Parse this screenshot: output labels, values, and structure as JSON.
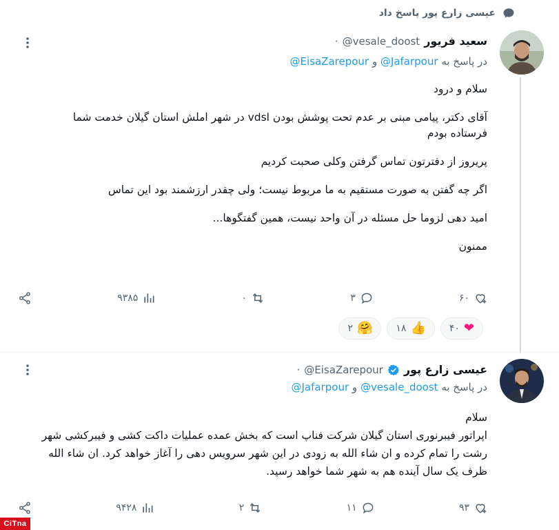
{
  "reply_context": {
    "text": "عیسی زارع پور پاسخ داد",
    "icon": "reply-bubble-icon"
  },
  "tweet1": {
    "name": "سعید فریور",
    "handle": "@vesale_doost",
    "dot": "·",
    "replying_prefix": "در پاسخ به",
    "replying_mention1": "@Jafarpour",
    "replying_and": "و",
    "replying_mention2": "@EisaZarepour",
    "body": [
      "سلام و درود",
      "آقای دکتر، پیامی مبنی بر عدم تحت پوشش بودن vdsl در شهر املش استان گیلان خدمت شما فرستاده بودم",
      "پریروز از دفترتون تماس گرفتن وکلی صحبت کردیم",
      "اگر چه گفتن به صورت مستقیم به ما مربوط نیست؛ ولی چقدر ارزشمند بود این تماس",
      "امید دهی لزوما حل مسئله در آن واحد نیست، همین گفتگوها...",
      "ممنون"
    ],
    "actions": {
      "reply": "۳",
      "repost": "۰",
      "like": "۶۰",
      "views": "۹۳۸۵"
    },
    "reactions": [
      {
        "emoji": "❤",
        "count": "۴۰",
        "icon": "heart-icon"
      },
      {
        "emoji": "👍",
        "count": "۱۸",
        "icon": "thumbs-up-icon"
      },
      {
        "emoji": "🤗",
        "count": "۲",
        "icon": "hugging-face-icon"
      }
    ]
  },
  "tweet2": {
    "name": "عیسی زارع پور",
    "handle": "@EisaZarepour",
    "dot": "·",
    "replying_prefix": "در پاسخ به",
    "replying_mention1": "@vesale_doost",
    "replying_and": "و",
    "replying_mention2": "@Jafarpour",
    "body": [
      "سلام",
      "اپراتور فیبرنوری استان گیلان شرکت فناپ است که بخش عمده عملیات داکت کشی و فیبرکشی شهر رشت را تمام کرده و ان شاء الله به زودی در این شهر سرویس دهی را آغاز خواهد کرد. ان شاء الله ظرف یک سال آینده هم به شهر شما خواهد رسید."
    ],
    "actions": {
      "reply": "۱۱",
      "repost": "۲",
      "like": "۹۳",
      "views": "۹۴۲۸"
    }
  },
  "watermark": "CiTna",
  "colors": {
    "accent": "#1d9bf0",
    "muted": "#536471",
    "verified": "#1d9bf0"
  }
}
